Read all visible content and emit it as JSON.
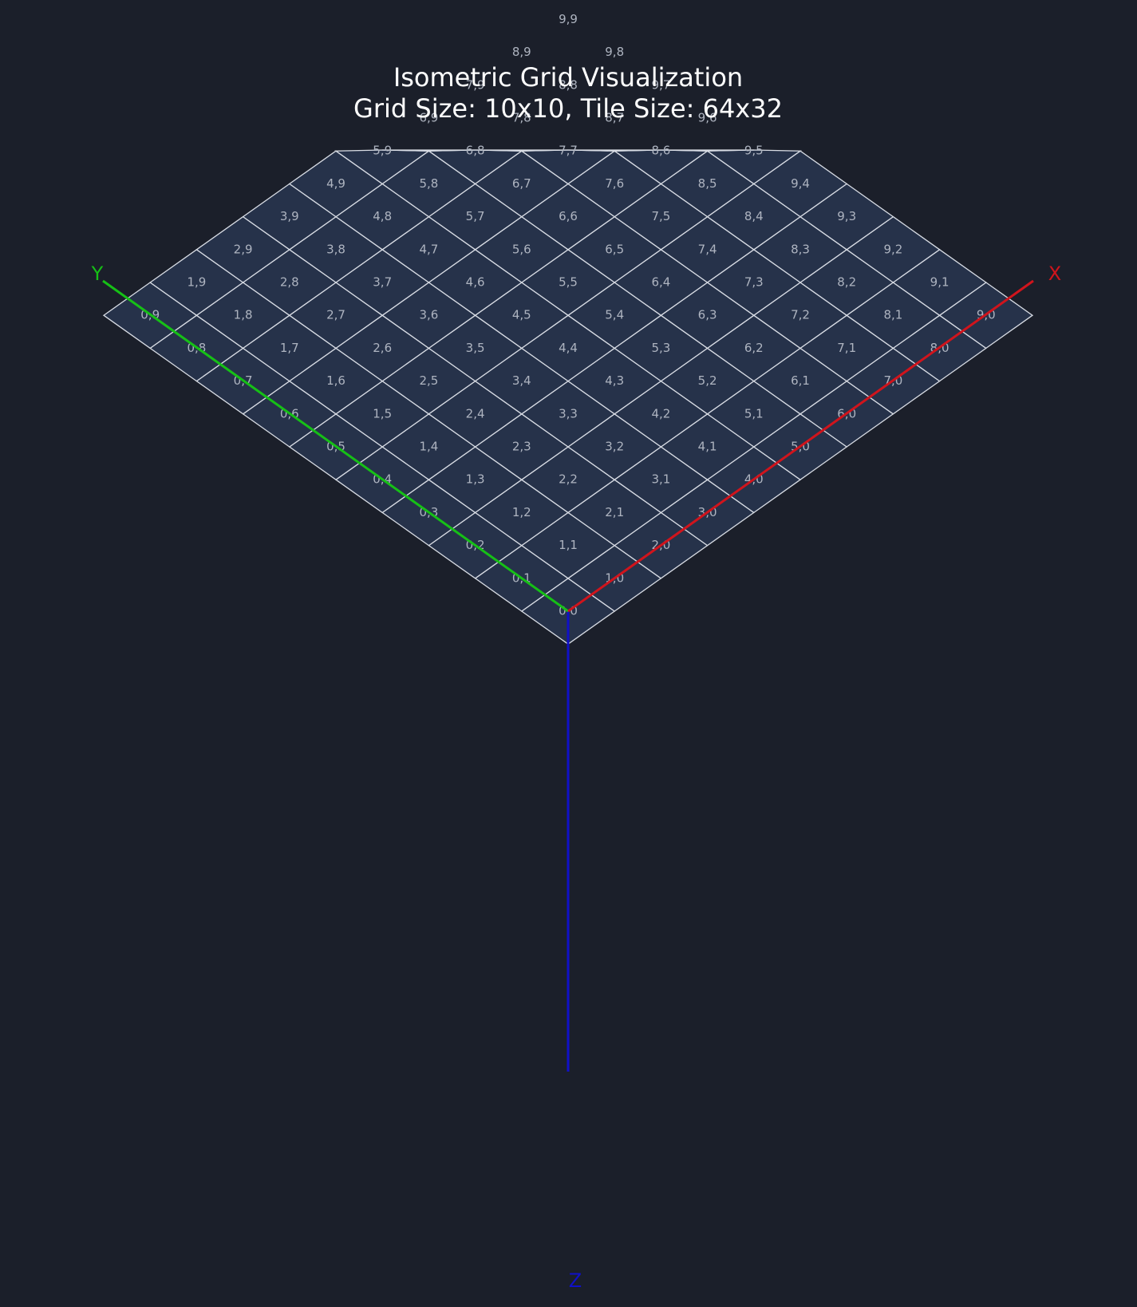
{
  "title": {
    "line1": "Isometric Grid Visualization",
    "line2": "Grid Size: 10x10, Tile Size: 64x32"
  },
  "grid": {
    "cols": 10,
    "rows": 10,
    "label_format": "x,y"
  },
  "axes": {
    "x": {
      "label": "X",
      "color": "#d0141c"
    },
    "y": {
      "label": "Y",
      "color": "#16c016"
    },
    "z": {
      "label": "Z",
      "color": "#1010c8"
    }
  },
  "colors": {
    "background": "#1b1f2a",
    "tile_fill": "#26324a",
    "tile_stroke": "#d8dce4",
    "label": "#aeb4c0",
    "title": "#ffffff"
  }
}
